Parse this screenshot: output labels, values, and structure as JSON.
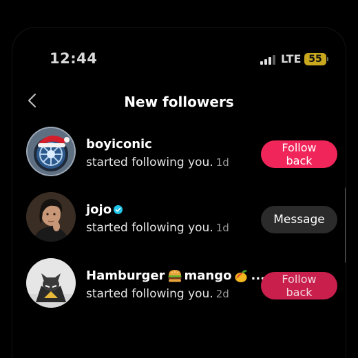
{
  "status_bar": {
    "time": "12:44",
    "network": "LTE",
    "battery": "55",
    "battery_color": "#c9a81f"
  },
  "header": {
    "title": "New followers",
    "back_icon": "chevron-left-icon"
  },
  "followers": [
    {
      "username": "boyiconic",
      "activity": "started following you.",
      "time_ago": "1d",
      "action_label": "Follow back",
      "verified": false
    },
    {
      "username": "jojo",
      "activity": "started following you.",
      "time_ago": "1d",
      "action_label": "Message",
      "verified": true
    },
    {
      "username": "Hamburger",
      "username_part2": "mango",
      "username_suffix": "...",
      "activity": "started following you.",
      "time_ago": "2d",
      "action_label": "Follow back",
      "verified": false,
      "emojis": [
        "hamburger-emoji",
        "mango-emoji"
      ]
    }
  ],
  "colors": {
    "follow_button": "#f0255a",
    "message_button": "#2b2b2b",
    "verified_badge": "#20c5e8"
  }
}
